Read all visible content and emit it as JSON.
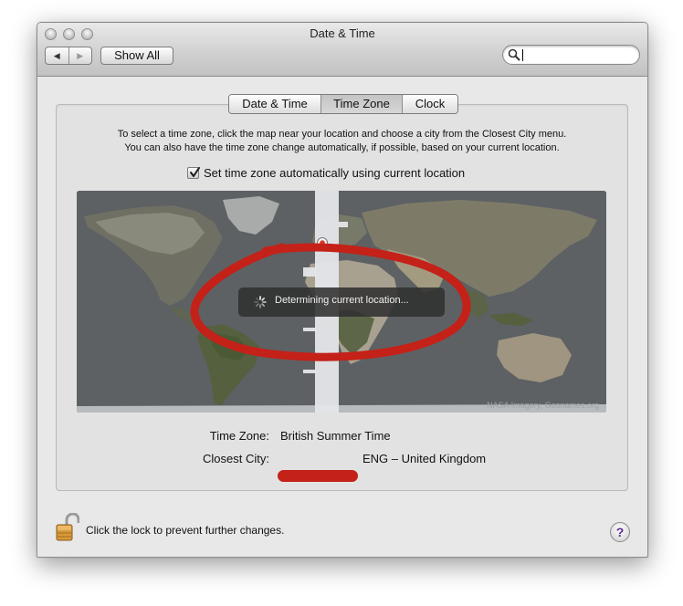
{
  "window": {
    "title": "Date & Time",
    "show_all_label": "Show All",
    "nav_back": "◀",
    "nav_forward": "▶",
    "search_placeholder": ""
  },
  "tabs": [
    {
      "label": "Date & Time",
      "selected": false
    },
    {
      "label": "Time Zone",
      "selected": true
    },
    {
      "label": "Clock",
      "selected": false
    }
  ],
  "instructions": {
    "line1": "To select a time zone, click the map near your location and choose a city from the Closest City menu.",
    "line2": "You can also have the time zone change automatically, if possible, based on your current location."
  },
  "auto_timezone": {
    "label": "Set time zone automatically using current location",
    "checked": true
  },
  "map": {
    "status_text": "Determining current location...",
    "credit": "NASA Imagery, Geonames.org"
  },
  "info": {
    "timezone_label": "Time Zone:",
    "timezone_value": "British Summer Time",
    "city_label": "Closest City:",
    "city_value": "ENG – United Kingdom"
  },
  "footer": {
    "lock_text": "Click the lock to prevent further changes.",
    "help_label": "?"
  },
  "colors": {
    "annotation_red": "#c42119",
    "map_ocean": "#5f6366",
    "timezone_band": "#e4e6ea"
  }
}
